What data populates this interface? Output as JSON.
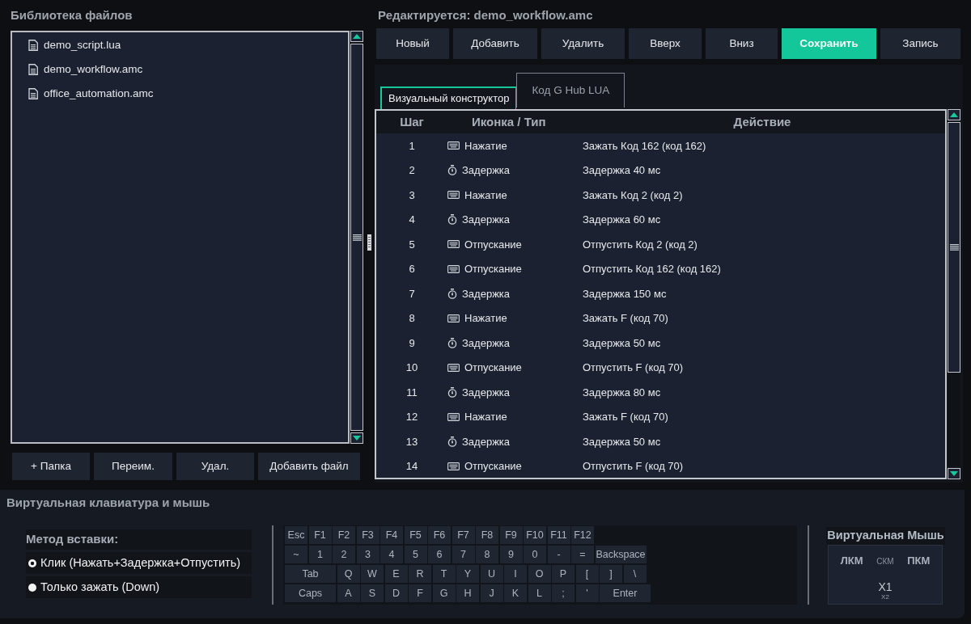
{
  "library": {
    "title": "Библиотека файлов",
    "files": [
      {
        "name": "demo_script.lua"
      },
      {
        "name": "demo_workflow.amc"
      },
      {
        "name": "office_automation.amc"
      }
    ],
    "buttons": [
      "+ Папка",
      "Переим.",
      "Удал.",
      "Добавить файл"
    ]
  },
  "editor": {
    "title": "Редактируется: demo_workflow.amc",
    "toolbar": [
      {
        "label": "Новый",
        "primary": false
      },
      {
        "label": "Добавить",
        "primary": false
      },
      {
        "label": "Удалить",
        "primary": false
      },
      {
        "label": "Вверх",
        "primary": false
      },
      {
        "label": "Вниз",
        "primary": false
      },
      {
        "label": "Сохранить",
        "primary": true
      },
      {
        "label": "Запись",
        "primary": false
      }
    ],
    "tabs": [
      {
        "label": "Визуальный конструктор",
        "selected": true
      },
      {
        "label": "Код G Hub LUA",
        "selected": false
      }
    ],
    "table": {
      "columns": [
        "Шаг",
        "Иконка / Тип",
        "Действие"
      ],
      "rows": [
        {
          "step": "1",
          "kind": "key",
          "type": "Нажатие",
          "action": "Зажать Код 162 (код 162)"
        },
        {
          "step": "2",
          "kind": "delay",
          "type": "Задержка",
          "action": "Задержка 40 мс"
        },
        {
          "step": "3",
          "kind": "key",
          "type": "Нажатие",
          "action": "Зажать Код 2 (код 2)"
        },
        {
          "step": "4",
          "kind": "delay",
          "type": "Задержка",
          "action": "Задержка 60 мс"
        },
        {
          "step": "5",
          "kind": "key",
          "type": "Отпускание",
          "action": "Отпустить Код 2 (код 2)"
        },
        {
          "step": "6",
          "kind": "key",
          "type": "Отпускание",
          "action": "Отпустить Код 162 (код 162)"
        },
        {
          "step": "7",
          "kind": "delay",
          "type": "Задержка",
          "action": "Задержка 150 мс"
        },
        {
          "step": "8",
          "kind": "key",
          "type": "Нажатие",
          "action": "Зажать F (код 70)"
        },
        {
          "step": "9",
          "kind": "delay",
          "type": "Задержка",
          "action": "Задержка 50 мс"
        },
        {
          "step": "10",
          "kind": "key",
          "type": "Отпускание",
          "action": "Отпустить F (код 70)"
        },
        {
          "step": "11",
          "kind": "delay",
          "type": "Задержка",
          "action": "Задержка 80 мс"
        },
        {
          "step": "12",
          "kind": "key",
          "type": "Нажатие",
          "action": "Зажать F (код 70)"
        },
        {
          "step": "13",
          "kind": "delay",
          "type": "Задержка",
          "action": "Задержка 50 мс"
        },
        {
          "step": "14",
          "kind": "key",
          "type": "Отпускание",
          "action": "Отпустить F (код 70)"
        }
      ]
    }
  },
  "virtual_input": {
    "title": "Виртуальная клавиатура и мышь",
    "insert_method": {
      "title": "Метод вставки:",
      "options": [
        {
          "label": "Клик (Нажать+Задержка+Отпустить)",
          "selected": true
        },
        {
          "label": "Только зажать (Down)",
          "selected": false
        }
      ]
    },
    "keyboard": {
      "rows": [
        {
          "keys": [
            {
              "label": "Esc",
              "kind": "key"
            },
            {
              "label": "F1",
              "kind": "key"
            },
            {
              "label": "F2",
              "kind": "key"
            },
            {
              "label": "F3",
              "kind": "key"
            },
            {
              "label": "F4",
              "kind": "key"
            },
            {
              "label": "F5",
              "kind": "key"
            },
            {
              "label": "F6",
              "kind": "key"
            },
            {
              "label": "F7",
              "kind": "key"
            },
            {
              "label": "F8",
              "kind": "key"
            },
            {
              "label": "F9",
              "kind": "key"
            },
            {
              "label": "F10",
              "kind": "key"
            },
            {
              "label": "F11",
              "kind": "key"
            },
            {
              "label": "F12",
              "kind": "key"
            }
          ]
        },
        {
          "keys": [
            {
              "label": "~",
              "kind": "key"
            },
            {
              "label": "1",
              "kind": "key"
            },
            {
              "label": "2",
              "kind": "key"
            },
            {
              "label": "3",
              "kind": "key"
            },
            {
              "label": "4",
              "kind": "key"
            },
            {
              "label": "5",
              "kind": "key"
            },
            {
              "label": "6",
              "kind": "key"
            },
            {
              "label": "7",
              "kind": "key"
            },
            {
              "label": "8",
              "kind": "key"
            },
            {
              "label": "9",
              "kind": "key"
            },
            {
              "label": "0",
              "kind": "key"
            },
            {
              "label": "-",
              "kind": "key"
            },
            {
              "label": "=",
              "kind": "key"
            },
            {
              "label": "Backspace",
              "kind": "wide"
            }
          ]
        },
        {
          "keys": [
            {
              "label": "Tab",
              "kind": "wide"
            },
            {
              "label": "Q",
              "kind": "key"
            },
            {
              "label": "W",
              "kind": "key"
            },
            {
              "label": "E",
              "kind": "key"
            },
            {
              "label": "R",
              "kind": "key"
            },
            {
              "label": "T",
              "kind": "key"
            },
            {
              "label": "Y",
              "kind": "key"
            },
            {
              "label": "U",
              "kind": "key"
            },
            {
              "label": "I",
              "kind": "key"
            },
            {
              "label": "O",
              "kind": "key"
            },
            {
              "label": "P",
              "kind": "key"
            },
            {
              "label": "[",
              "kind": "key"
            },
            {
              "label": "]",
              "kind": "key"
            },
            {
              "label": "\\",
              "kind": "key"
            }
          ]
        },
        {
          "keys": [
            {
              "label": "Caps",
              "kind": "wide"
            },
            {
              "label": "A",
              "kind": "key"
            },
            {
              "label": "S",
              "kind": "key"
            },
            {
              "label": "D",
              "kind": "key"
            },
            {
              "label": "F",
              "kind": "key"
            },
            {
              "label": "G",
              "kind": "key"
            },
            {
              "label": "H",
              "kind": "key"
            },
            {
              "label": "J",
              "kind": "key"
            },
            {
              "label": "K",
              "kind": "key"
            },
            {
              "label": "L",
              "kind": "key"
            },
            {
              "label": ";",
              "kind": "key"
            },
            {
              "label": "'",
              "kind": "key"
            },
            {
              "label": "Enter",
              "kind": "wide"
            }
          ]
        }
      ]
    },
    "mouse": {
      "title": "Виртуальная Мышь",
      "buttons": [
        {
          "label": "ЛКМ",
          "kind": "bold"
        },
        {
          "label": "СКМ",
          "kind": "small"
        },
        {
          "label": "ПКМ",
          "kind": "bold"
        }
      ],
      "side_buttons": [
        {
          "label": "X1",
          "kind": "plain"
        },
        {
          "label": "X2",
          "kind": "tiny"
        }
      ]
    }
  }
}
